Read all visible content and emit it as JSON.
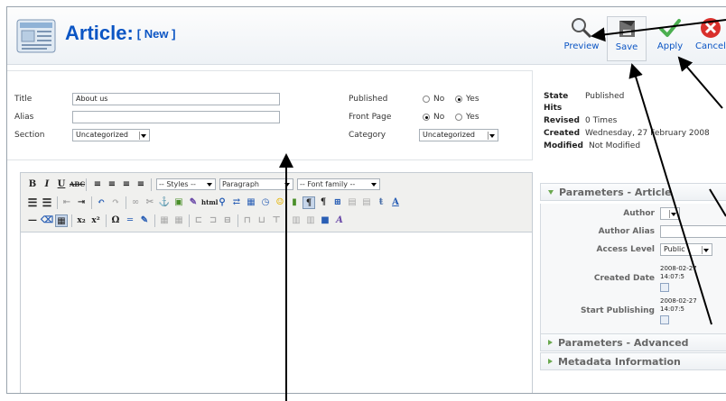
{
  "header": {
    "title": "Article:",
    "subtitle": "[ New ]"
  },
  "toolbar": {
    "preview_label": "Preview",
    "save_label": "Save",
    "apply_label": "Apply",
    "cancel_label": "Cancel"
  },
  "details": {
    "title_label": "Title",
    "title_value": "About us",
    "alias_label": "Alias",
    "alias_value": "",
    "section_label": "Section",
    "section_value": "Uncategorized",
    "published_label": "Published",
    "frontpage_label": "Front Page",
    "category_label": "Category",
    "category_value": "Uncategorized",
    "no_label": "No",
    "yes_label": "Yes",
    "published_selected": "Yes",
    "frontpage_selected": "No"
  },
  "info": {
    "state_label": "State",
    "state_value": "Published",
    "hits_label": "Hits",
    "hits_value": "",
    "revised_label": "Revised",
    "revised_value": "0 Times",
    "created_label": "Created",
    "created_value": "Wednesday, 27 February 2008",
    "modified_label": "Modified",
    "modified_value": "Not Modified"
  },
  "editor": {
    "styles_select": "-- Styles --",
    "format_select": "Paragraph",
    "font_select": "-- Font family --"
  },
  "params_article": {
    "heading": "Parameters - Article",
    "author_label": "Author",
    "author_value": "",
    "author_alias_label": "Author Alias",
    "author_alias_value": "",
    "access_label": "Access Level",
    "access_value": "Public",
    "created_date_label": "Created Date",
    "created_date_value": "2008-02-27 14:07:5",
    "start_label": "Start Publishing",
    "start_value": "2008-02-27 14:07:5"
  },
  "params_advanced": {
    "heading": "Parameters - Advanced"
  },
  "metadata": {
    "heading": "Metadata Information"
  },
  "colors": {
    "title_blue": "#0b55c4",
    "panel_green": "#6aa84f",
    "cancel_red": "#d9302c",
    "apply_green": "#4caf50"
  }
}
